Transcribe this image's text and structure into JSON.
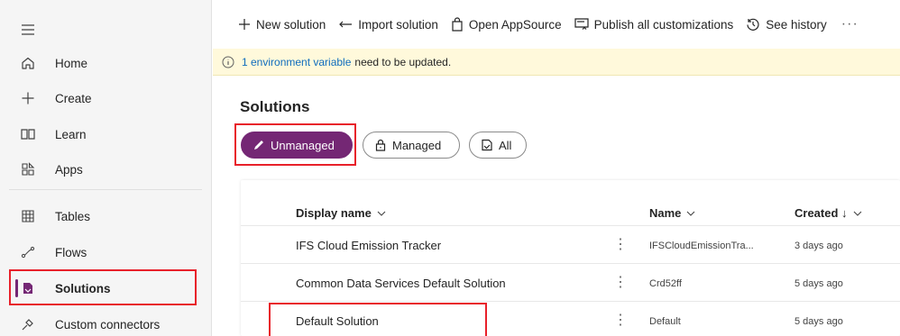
{
  "sidebar": {
    "items": [
      {
        "label": "Home",
        "icon": "home-icon"
      },
      {
        "label": "Create",
        "icon": "plus-icon"
      },
      {
        "label": "Learn",
        "icon": "book-icon"
      },
      {
        "label": "Apps",
        "icon": "apps-icon"
      },
      {
        "label": "Tables",
        "icon": "table-icon"
      },
      {
        "label": "Flows",
        "icon": "flow-icon"
      },
      {
        "label": "Solutions",
        "icon": "solutions-icon"
      },
      {
        "label": "Custom connectors",
        "icon": "connector-icon"
      }
    ],
    "active": "Solutions"
  },
  "commandbar": {
    "new_solution": "New solution",
    "import_solution": "Import solution",
    "open_appsource": "Open AppSource",
    "publish_all": "Publish all customizations",
    "see_history": "See history",
    "more": "···"
  },
  "notice": {
    "link_text": "1 environment variable",
    "rest_text": "need to be updated."
  },
  "main": {
    "title": "Solutions",
    "filters": [
      {
        "label": "Unmanaged",
        "selected": true
      },
      {
        "label": "Managed",
        "selected": false
      },
      {
        "label": "All",
        "selected": false
      }
    ]
  },
  "table": {
    "columns": {
      "display_name": "Display name",
      "name": "Name",
      "created": "Created ↓"
    },
    "rows": [
      {
        "display_name": "IFS Cloud Emission Tracker",
        "name": "IFSCloudEmissionTra...",
        "created": "3 days ago"
      },
      {
        "display_name": "Common Data Services Default Solution",
        "name": "Crd52ff",
        "created": "5 days ago"
      },
      {
        "display_name": "Default Solution",
        "name": "Default",
        "created": "5 days ago"
      }
    ],
    "row_menu": "⋮"
  },
  "colors": {
    "accent": "#742774",
    "highlight_box": "#e8202a",
    "notice_bg": "#fff9db",
    "link": "#0f6cbd"
  }
}
